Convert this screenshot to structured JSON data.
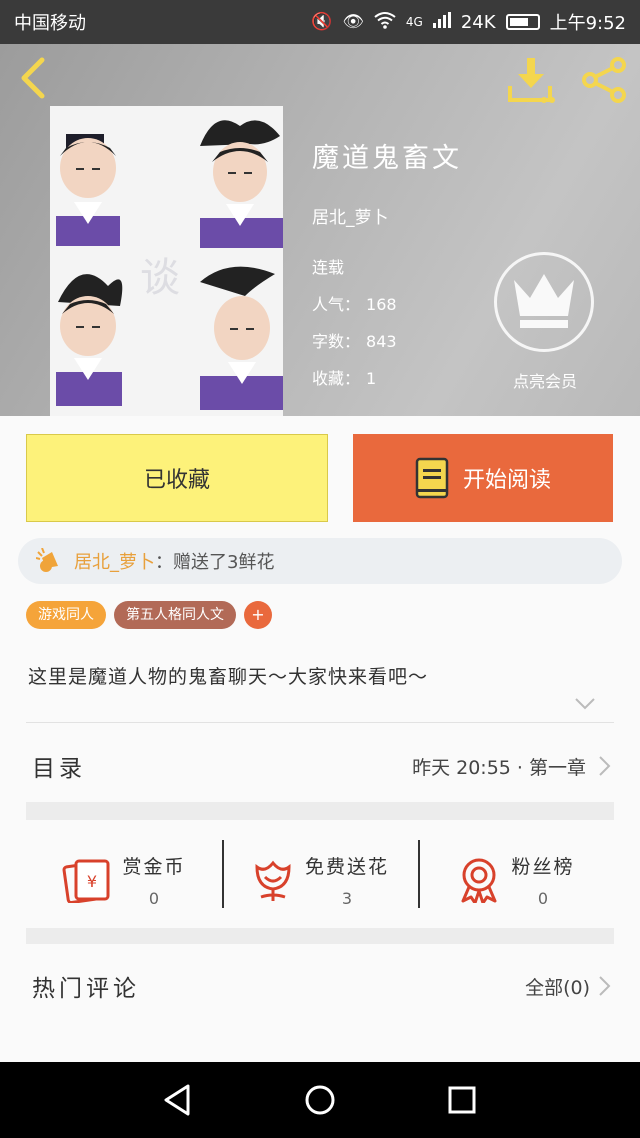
{
  "status_bar": {
    "carrier": "中国移动",
    "network": "4G",
    "speed": "24K",
    "time": "上午9:52"
  },
  "header": {
    "book_title": "魔道鬼畜文",
    "author": "居北_萝卜",
    "status": "连载",
    "popularity_label": "人气：",
    "popularity": "168",
    "word_count_label": "字数：",
    "word_count": "843",
    "favorites_label": "收藏：",
    "favorites": "1",
    "vip_label": "点亮会员"
  },
  "actions": {
    "collected_label": "已收藏",
    "read_label": "开始阅读"
  },
  "gift": {
    "user": "居北_萝卜",
    "message": "：赠送了3鲜花"
  },
  "tags": [
    "游戏同人",
    "第五人格同人文"
  ],
  "tag_add": "+",
  "description": "这里是魔道人物的鬼畜聊天～大家快来看吧～",
  "toc": {
    "label": "目录",
    "latest": "昨天 20:55 · 第一章"
  },
  "stats": [
    {
      "label": "赏金币",
      "value": "0",
      "icon": "red-envelope-icon"
    },
    {
      "label": "免费送花",
      "value": "3",
      "icon": "flower-icon"
    },
    {
      "label": "粉丝榜",
      "value": "0",
      "icon": "medal-icon"
    }
  ],
  "comments": {
    "label": "热门评论",
    "all": "全部(0)"
  },
  "colors": {
    "accent_orange": "#e9693d",
    "collected_yellow": "#fdf27a",
    "icon_yellow": "#f4d64e",
    "tag_orange": "#f5a43a",
    "tag_brown": "#b26a57",
    "stat_red": "#d8412b"
  }
}
